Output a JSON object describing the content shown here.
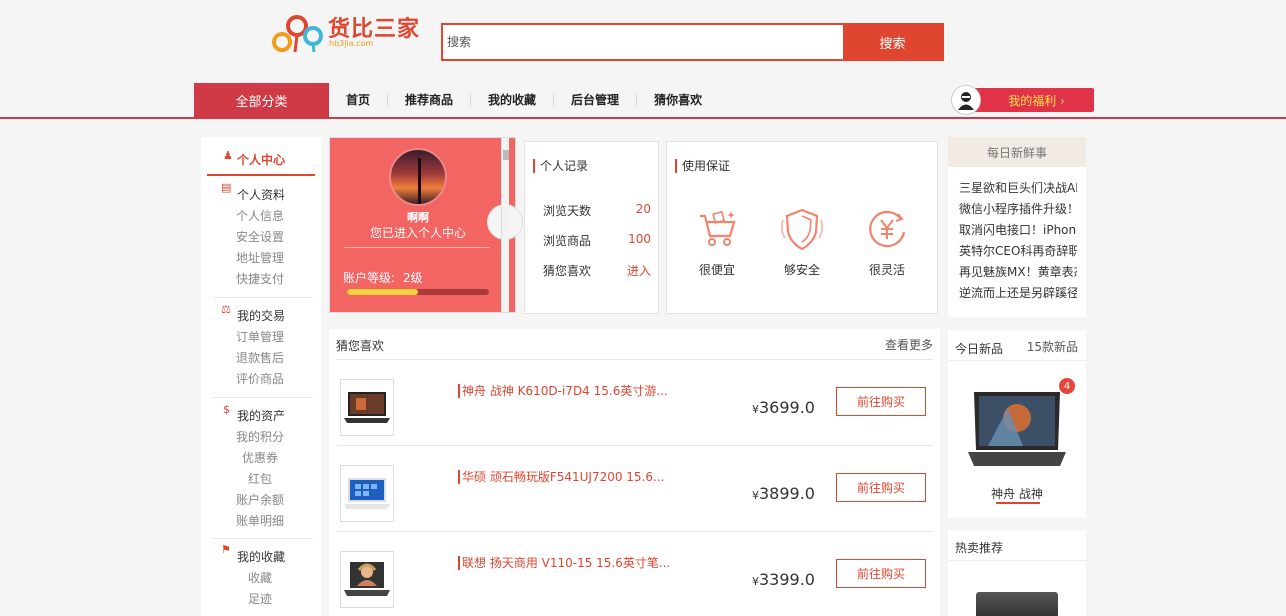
{
  "header": {
    "logo_text": "货比三家",
    "logo_sub": "hb3jia.com",
    "search_placeholder": "搜索",
    "search_button": "搜索"
  },
  "nav": {
    "all_categories": "全部分类",
    "items": [
      "首页",
      "推荐商品",
      "我的收藏",
      "后台管理",
      "猜你喜欢"
    ],
    "welfare": "我的福利 ›"
  },
  "sidebar": {
    "head": "个人中心",
    "groups": [
      {
        "title": "个人资料",
        "links": [
          "个人信息",
          "安全设置",
          "地址管理",
          "快捷支付"
        ]
      },
      {
        "title": "我的交易",
        "links": [
          "订单管理",
          "退款售后",
          "评价商品"
        ]
      },
      {
        "title": "我的资产",
        "links": [
          "我的积分",
          "优惠券",
          "红包",
          "账户余额",
          "账单明细"
        ]
      },
      {
        "title": "我的收藏",
        "links": [
          "收藏",
          "足迹"
        ]
      }
    ]
  },
  "profile": {
    "name": "啊啊",
    "tip": "您已进入个人中心",
    "level_label": "账户等级:",
    "level_value": "2级",
    "level_progress": 0.5
  },
  "records": {
    "title": "个人记录",
    "rows": [
      {
        "label": "浏览天数",
        "value": "20"
      },
      {
        "label": "浏览商品",
        "value": "100"
      },
      {
        "label": "猜您喜欢",
        "value": "进入"
      }
    ]
  },
  "guarantee": {
    "title": "使用保证",
    "items": [
      "很便宜",
      "够安全",
      "很灵活"
    ]
  },
  "news": {
    "title": "每日新鲜事",
    "items": [
      "三星欲和巨头们决战AI",
      "微信小程序插件升级！",
      "取消闪电接口！iPhone",
      "英特尔CEO科再奇辞职",
      "再见魅族MX！黄章表态",
      "逆流而上还是另辟蹊径"
    ]
  },
  "guess": {
    "title": "猜您喜欢",
    "more": "查看更多",
    "products": [
      {
        "name": "神舟 战神 K610D-i7D4 15.6英寸游...",
        "currency": "¥",
        "price": "3699.0",
        "button": "前往购买"
      },
      {
        "name": "华硕 顽石畅玩版F541UJ7200 15.6...",
        "currency": "¥",
        "price": "3899.0",
        "button": "前往购买"
      },
      {
        "name": "联想 扬天商用 V110-15 15.6英寸笔...",
        "currency": "¥",
        "price": "3399.0",
        "button": "前往购买"
      }
    ]
  },
  "new_today": {
    "title": "今日新品",
    "count": "15款新品",
    "badge": "4",
    "product_name": "神舟 战神"
  },
  "hot": {
    "title": "热卖推荐"
  },
  "colors": {
    "accent": "#e0452f",
    "nav_red": "#d03a46",
    "profile_bg": "#f26563"
  }
}
